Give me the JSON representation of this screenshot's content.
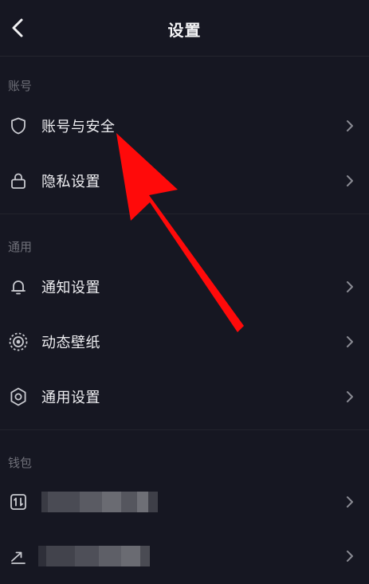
{
  "header": {
    "title": "设置",
    "back_icon": "chevron-left-icon"
  },
  "sections": {
    "account": {
      "label": "账号",
      "items": [
        {
          "label": "账号与安全",
          "icon": "shield-icon"
        },
        {
          "label": "隐私设置",
          "icon": "lock-icon"
        }
      ]
    },
    "general": {
      "label": "通用",
      "items": [
        {
          "label": "通知设置",
          "icon": "bell-icon"
        },
        {
          "label": "动态壁纸",
          "icon": "live-wallpaper-icon"
        },
        {
          "label": "通用设置",
          "icon": "gear-icon"
        }
      ]
    },
    "wallet": {
      "label": "钱包",
      "items": [
        {
          "label": "",
          "icon": "wallet-balance-icon",
          "obscured": true
        },
        {
          "label": "",
          "icon": "trend-arrow-icon",
          "obscured": true
        }
      ]
    }
  },
  "annotation": {
    "color": "#ff0a0a",
    "target": "账号与安全"
  },
  "colors": {
    "background": "#161722",
    "text": "#eeeef1",
    "muted": "#6e6f78",
    "chevron": "#8a8b93"
  }
}
